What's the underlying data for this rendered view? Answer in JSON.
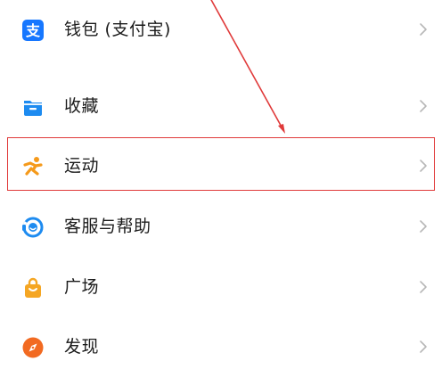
{
  "menu": {
    "items": [
      {
        "label": "钱包 (支付宝)",
        "icon": "alipay-icon",
        "icon_color": "#1677ff"
      },
      {
        "label": "收藏",
        "icon": "folder-icon",
        "icon_color": "#1d8bf0"
      },
      {
        "label": "运动",
        "icon": "runner-icon",
        "icon_color": "#f59a1b"
      },
      {
        "label": "客服与帮助",
        "icon": "customer-service-icon",
        "icon_color": "#1d8bf0"
      },
      {
        "label": "广场",
        "icon": "shopping-bag-icon",
        "icon_color": "#f5a623"
      },
      {
        "label": "发现",
        "icon": "compass-icon",
        "icon_color": "#f26a21"
      }
    ]
  },
  "annotation": {
    "highlight_color": "#e03a3a",
    "highlighted_item": "运动"
  }
}
